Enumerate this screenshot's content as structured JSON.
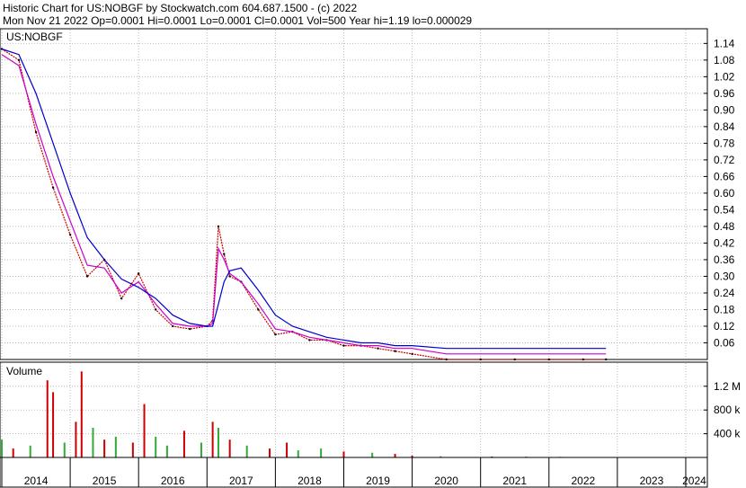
{
  "header": {
    "line1": "Historic Chart for US:NOBGF by Stockwatch.com 604.687.1500 - (c) 2022",
    "line2": "Mon Nov 21 2022   Op=0.0001  Hi=0.0001  Lo=0.0001  Cl=0.0001  Vol=500  Year hi=1.19  lo=0.000029"
  },
  "colors": {
    "price": "#cc0000",
    "ma_short": "#cc00cc",
    "ma_long": "#0000cc",
    "volume_up": "#33aa33",
    "volume_down": "#cc0000",
    "grid": "#bbbbbb"
  },
  "chart_data": [
    {
      "type": "line",
      "title": "US:NOBGF",
      "x": [
        "2014-01",
        "2014-04",
        "2014-07",
        "2014-10",
        "2015-01",
        "2015-04",
        "2015-07",
        "2015-10",
        "2016-01",
        "2016-04",
        "2016-07",
        "2016-10",
        "2017-01",
        "2017-02",
        "2017-03",
        "2017-04",
        "2017-05",
        "2017-07",
        "2017-10",
        "2018-01",
        "2018-04",
        "2018-07",
        "2018-10",
        "2019-01",
        "2019-04",
        "2019-07",
        "2019-10",
        "2020-01",
        "2020-07",
        "2021-01",
        "2021-07",
        "2022-01",
        "2022-07",
        "2022-11"
      ],
      "series": [
        {
          "values": [
            1.12,
            1.08,
            0.82,
            0.62,
            0.45,
            0.3,
            0.36,
            0.22,
            0.31,
            0.18,
            0.12,
            0.11,
            0.12,
            0.14,
            0.48,
            0.38,
            0.3,
            0.28,
            0.18,
            0.09,
            0.1,
            0.07,
            0.07,
            0.05,
            0.05,
            0.04,
            0.03,
            0.02,
            0.0001,
            0.0001,
            0.0001,
            0.0001,
            0.0001,
            0.0001
          ]
        },
        {
          "values": [
            1.1,
            1.06,
            0.85,
            0.66,
            0.5,
            0.34,
            0.33,
            0.24,
            0.28,
            0.2,
            0.13,
            0.12,
            0.12,
            0.13,
            0.4,
            0.36,
            0.31,
            0.28,
            0.2,
            0.11,
            0.1,
            0.08,
            0.07,
            0.06,
            0.05,
            0.05,
            0.04,
            0.04,
            0.02,
            0.02,
            0.02,
            0.02,
            0.02,
            0.02
          ]
        },
        {
          "values": [
            1.12,
            1.1,
            0.96,
            0.78,
            0.6,
            0.44,
            0.36,
            0.29,
            0.26,
            0.22,
            0.16,
            0.13,
            0.12,
            0.12,
            0.2,
            0.28,
            0.32,
            0.33,
            0.25,
            0.16,
            0.12,
            0.1,
            0.08,
            0.07,
            0.06,
            0.06,
            0.05,
            0.05,
            0.04,
            0.04,
            0.04,
            0.04,
            0.04,
            0.04
          ]
        }
      ],
      "ylim": [
        0.0,
        1.18
      ],
      "yticks": [
        "1.14",
        "1.08",
        "1.02",
        "0.96",
        "0.90",
        "0.84",
        "0.78",
        "0.72",
        "0.66",
        "0.60",
        "0.54",
        "0.48",
        "0.42",
        "0.36",
        "0.30",
        "0.24",
        "0.18",
        "0.12",
        "0.06"
      ],
      "ytick_values": [
        1.14,
        1.08,
        1.02,
        0.96,
        0.9,
        0.84,
        0.78,
        0.72,
        0.66,
        0.6,
        0.54,
        0.48,
        0.42,
        0.36,
        0.3,
        0.24,
        0.18,
        0.12,
        0.06
      ],
      "grid": true
    },
    {
      "type": "bar",
      "title": "Volume",
      "ylim": [
        0,
        1500000
      ],
      "yticks": [
        "1.2 M",
        "800 k",
        "400 k"
      ],
      "ytick_values": [
        1200000,
        800000,
        400000
      ],
      "bars": [
        {
          "x": "2014-01",
          "v": 300000,
          "dir": "up"
        },
        {
          "x": "2014-03",
          "v": 150000,
          "dir": "down"
        },
        {
          "x": "2014-06",
          "v": 200000,
          "dir": "up"
        },
        {
          "x": "2014-09",
          "v": 1300000,
          "dir": "down"
        },
        {
          "x": "2014-10",
          "v": 1100000,
          "dir": "down"
        },
        {
          "x": "2014-12",
          "v": 250000,
          "dir": "up"
        },
        {
          "x": "2015-02",
          "v": 600000,
          "dir": "down"
        },
        {
          "x": "2015-03",
          "v": 1450000,
          "dir": "down"
        },
        {
          "x": "2015-05",
          "v": 500000,
          "dir": "up"
        },
        {
          "x": "2015-07",
          "v": 300000,
          "dir": "down"
        },
        {
          "x": "2015-09",
          "v": 350000,
          "dir": "up"
        },
        {
          "x": "2015-12",
          "v": 250000,
          "dir": "down"
        },
        {
          "x": "2016-02",
          "v": 900000,
          "dir": "down"
        },
        {
          "x": "2016-04",
          "v": 350000,
          "dir": "up"
        },
        {
          "x": "2016-06",
          "v": 200000,
          "dir": "up"
        },
        {
          "x": "2016-09",
          "v": 450000,
          "dir": "down"
        },
        {
          "x": "2016-12",
          "v": 250000,
          "dir": "up"
        },
        {
          "x": "2017-02",
          "v": 600000,
          "dir": "down"
        },
        {
          "x": "2017-03",
          "v": 500000,
          "dir": "up"
        },
        {
          "x": "2017-05",
          "v": 300000,
          "dir": "down"
        },
        {
          "x": "2017-08",
          "v": 200000,
          "dir": "up"
        },
        {
          "x": "2017-12",
          "v": 150000,
          "dir": "down"
        },
        {
          "x": "2018-03",
          "v": 250000,
          "dir": "down"
        },
        {
          "x": "2018-05",
          "v": 120000,
          "dir": "up"
        },
        {
          "x": "2018-09",
          "v": 150000,
          "dir": "up"
        },
        {
          "x": "2019-01",
          "v": 100000,
          "dir": "down"
        },
        {
          "x": "2019-06",
          "v": 80000,
          "dir": "up"
        },
        {
          "x": "2019-10",
          "v": 60000,
          "dir": "down"
        },
        {
          "x": "2020-01",
          "v": 30000,
          "dir": "down"
        },
        {
          "x": "2020-06",
          "v": 20000,
          "dir": "up"
        },
        {
          "x": "2021-03",
          "v": 15000,
          "dir": "down"
        },
        {
          "x": "2021-09",
          "v": 15000,
          "dir": "up"
        },
        {
          "x": "2022-03",
          "v": 10000,
          "dir": "down"
        },
        {
          "x": "2022-11",
          "v": 500,
          "dir": "down"
        }
      ]
    }
  ],
  "xaxis": {
    "labels": [
      "2014",
      "2015",
      "2016",
      "2017",
      "2018",
      "2019",
      "2020",
      "2021",
      "2022",
      "2023",
      "2024"
    ],
    "values": [
      "2014-01",
      "2015-01",
      "2016-01",
      "2017-01",
      "2018-01",
      "2019-01",
      "2020-01",
      "2021-01",
      "2022-01",
      "2023-01",
      "2024-01"
    ],
    "range": [
      "2014-01",
      "2024-04"
    ]
  }
}
